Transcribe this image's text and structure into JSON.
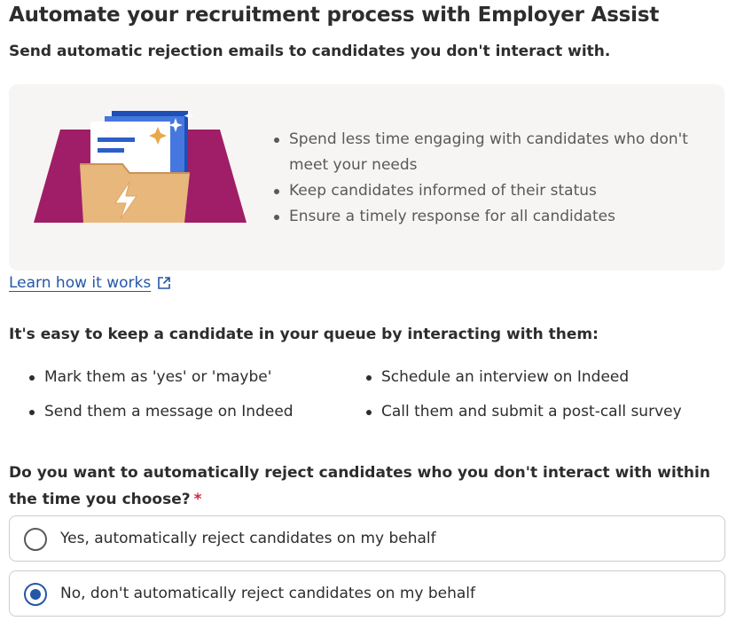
{
  "header": {
    "title": "Automate your recruitment process with Employer Assist",
    "subtitle": "Send automatic rejection emails to candidates you don't interact with."
  },
  "benefits": [
    "Spend less time engaging with candidates who don't meet your needs",
    "Keep candidates informed of their status",
    "Ensure a timely response for all candidates"
  ],
  "learn_link": {
    "label": "Learn how it works",
    "icon": "external-link-icon"
  },
  "interaction": {
    "heading": "It's easy to keep a candidate in your queue by interacting with them:",
    "items": [
      "Mark them as 'yes' or 'maybe'",
      "Schedule an interview on Indeed",
      "Send them a message on Indeed",
      "Call them and submit a post-call survey"
    ]
  },
  "question": {
    "label": "Do you want to automatically reject candidates who you don't interact with within the time you choose?",
    "required_marker": "*",
    "options": [
      {
        "label": "Yes, automatically reject candidates on my behalf",
        "selected": false
      },
      {
        "label": "No, don't automatically reject candidates on my behalf",
        "selected": true
      }
    ]
  },
  "colors": {
    "link": "#2557a7",
    "required": "#d5283d",
    "panel_bg": "#f7f5f3",
    "illustration_purple": "#a01e68",
    "illustration_folder": "#e8b77c",
    "illustration_blue": "#2c5fc8"
  }
}
